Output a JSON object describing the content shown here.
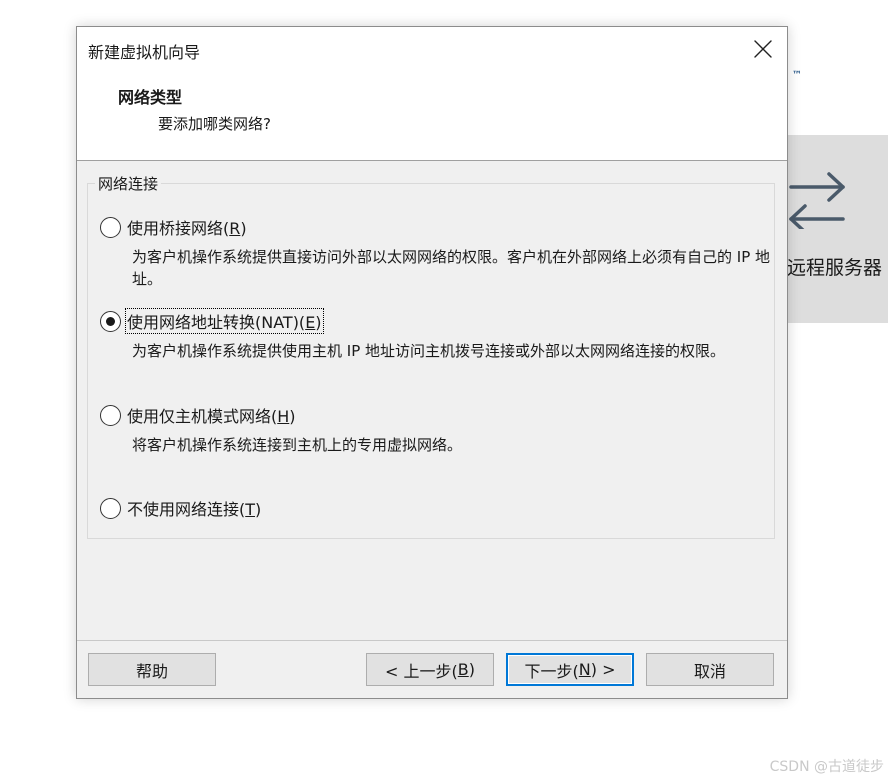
{
  "background": {
    "trademark": "™",
    "tile_label": "远程服务器"
  },
  "watermark": "CSDN @古道徒步",
  "dialog": {
    "title": "新建虚拟机向导",
    "heading": "网络类型",
    "subheading": "要添加哪类网络?",
    "group_label": "网络连接",
    "options": [
      {
        "label_pre": "使用桥接网络(",
        "mnemonic": "R",
        "label_post": ")",
        "description": "为客户机操作系统提供直接访问外部以太网网络的权限。客户机在外部网络上必须有自己的 IP 地址。",
        "checked": false
      },
      {
        "label_pre": "使用网络地址转换(NAT)(",
        "mnemonic": "E",
        "label_post": ")",
        "description": "为客户机操作系统提供使用主机 IP 地址访问主机拨号连接或外部以太网网络连接的权限。",
        "checked": true
      },
      {
        "label_pre": "使用仅主机模式网络(",
        "mnemonic": "H",
        "label_post": ")",
        "description": "将客户机操作系统连接到主机上的专用虚拟网络。",
        "checked": false
      },
      {
        "label_pre": "不使用网络连接(",
        "mnemonic": "T",
        "label_post": ")",
        "checked": false
      }
    ],
    "buttons": {
      "help": "帮助",
      "back_pre": "< 上一步(",
      "back_mnemonic": "B",
      "back_post": ")",
      "next_pre": "下一步(",
      "next_mnemonic": "N",
      "next_post": ") >",
      "cancel": "取消"
    }
  }
}
